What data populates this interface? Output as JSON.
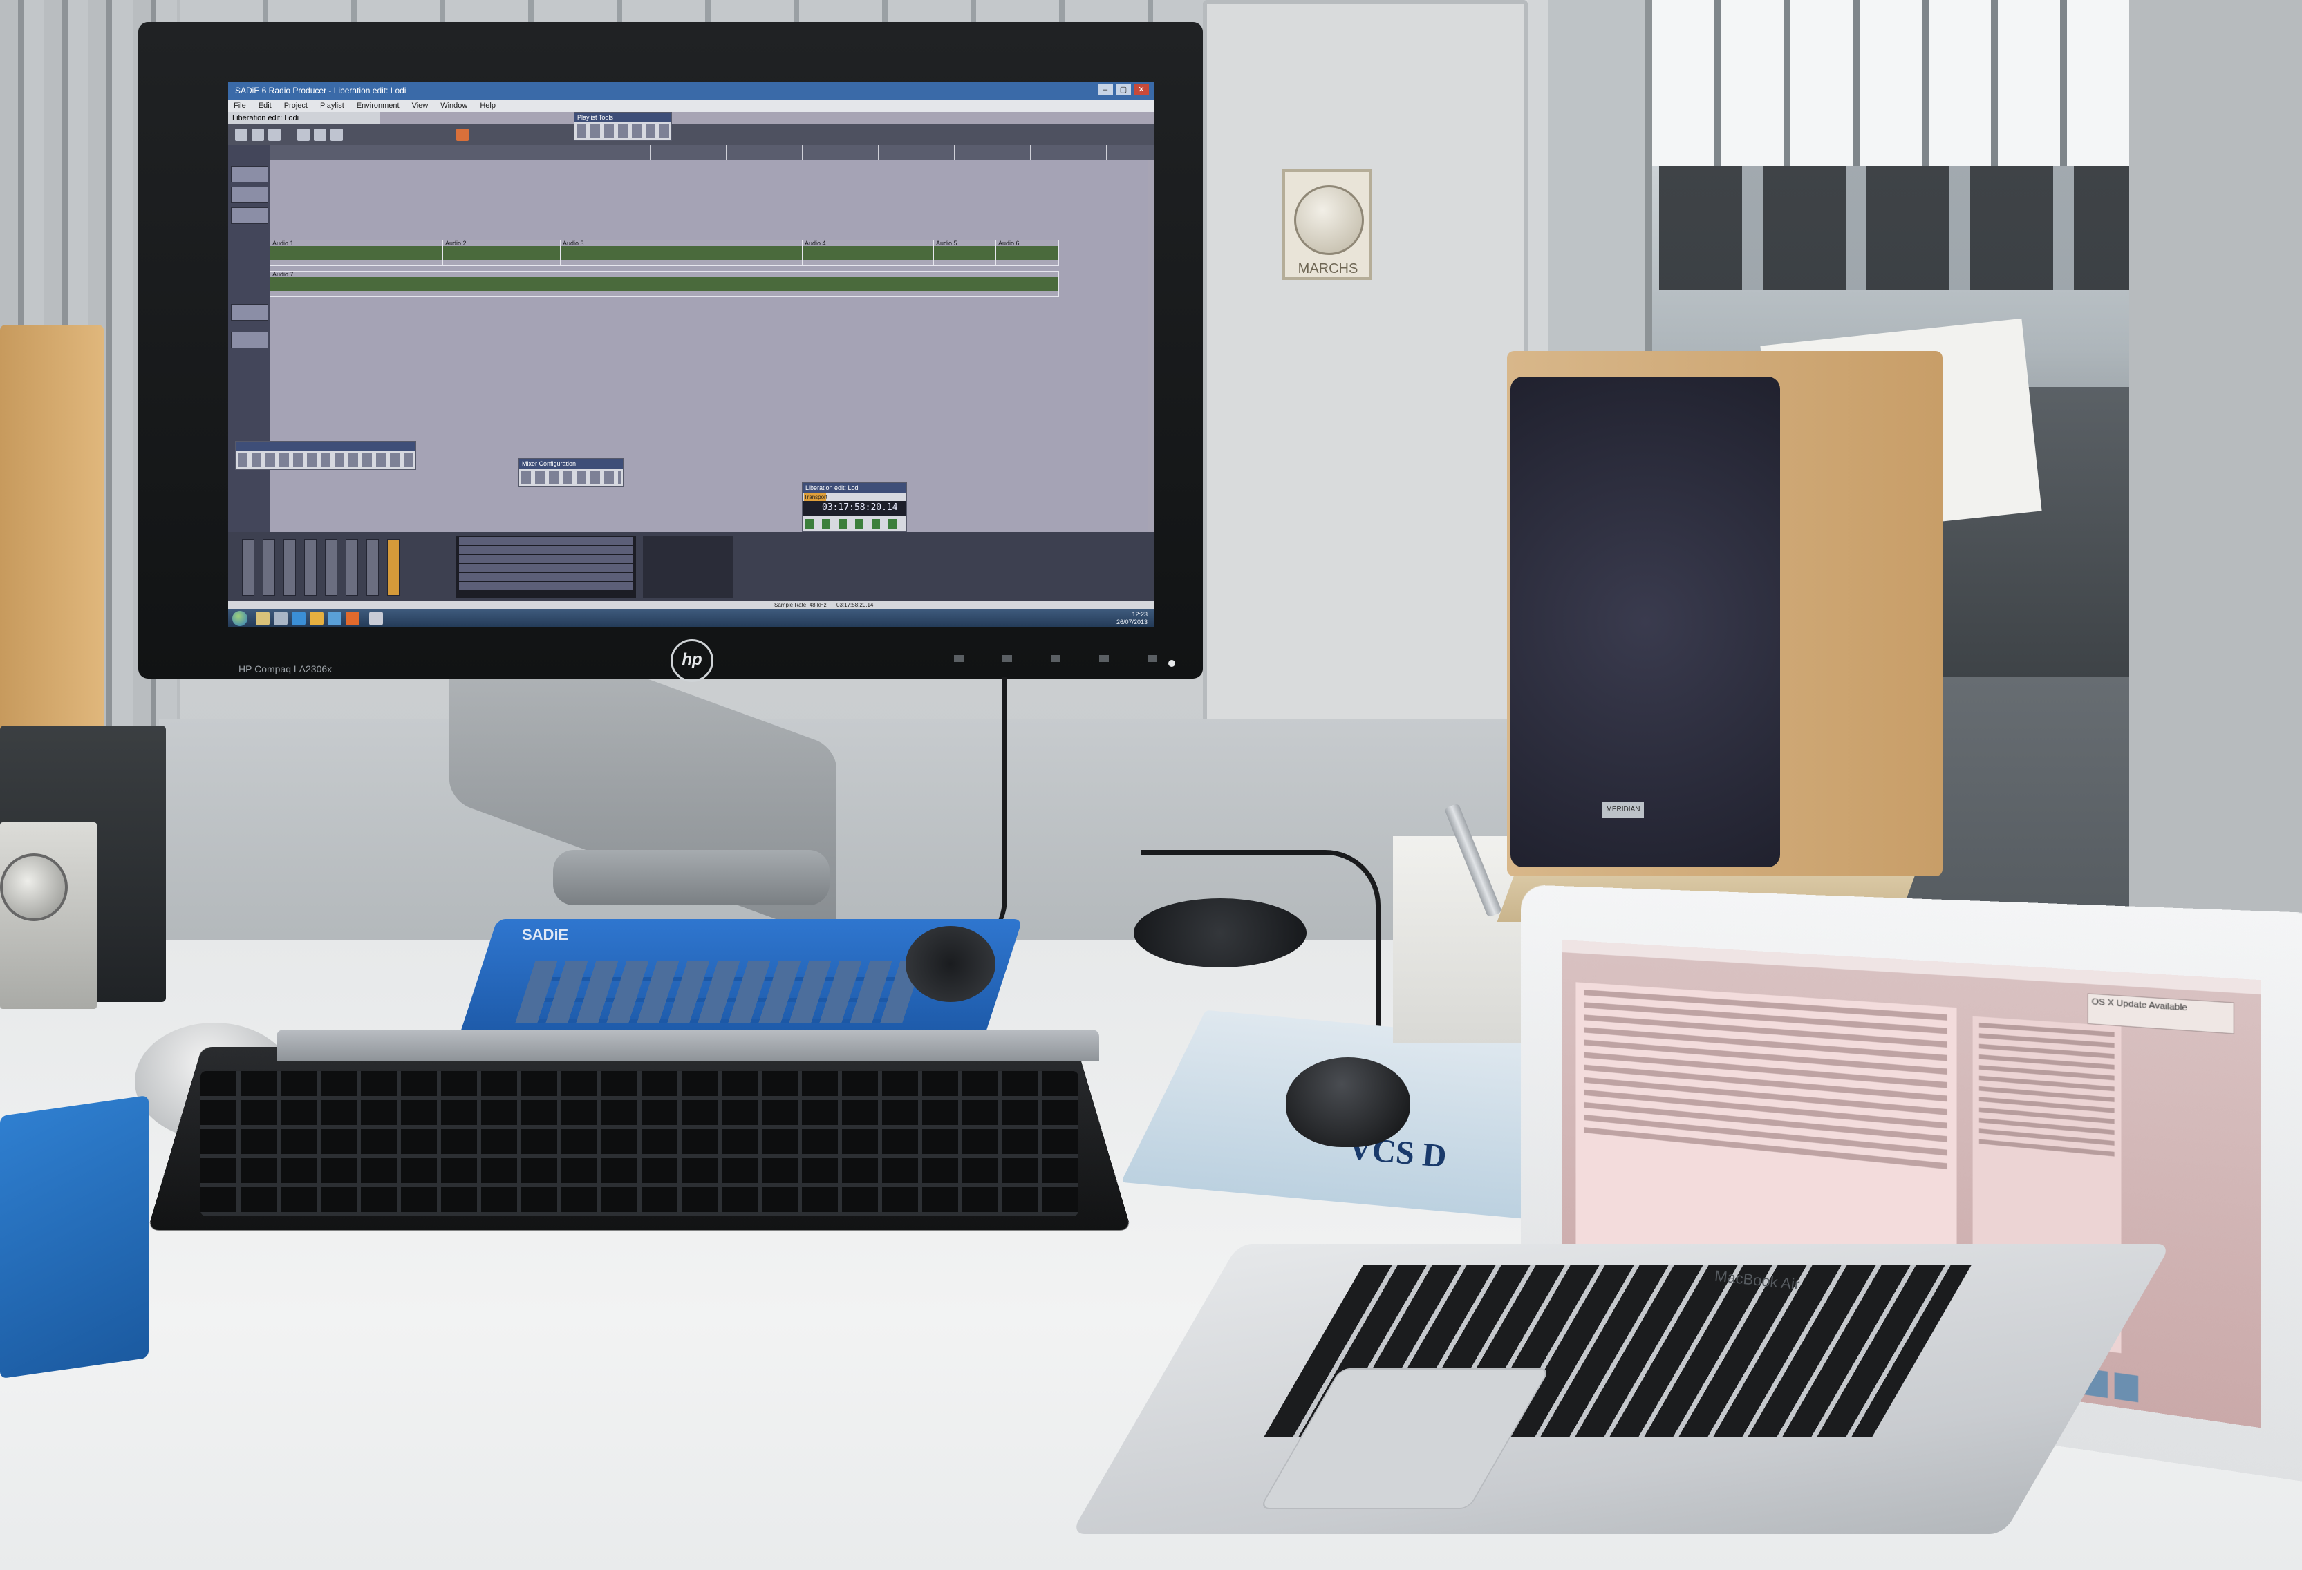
{
  "scene": {
    "monitor_model": "HP Compaq LA2306x",
    "monitor_logo": "hp",
    "speaker_badge": "MERIDIAN",
    "switch_brand": "MARCHS",
    "controller_label": "SADiE",
    "mousepad_text": "VCS D",
    "laptop_label": "MacBook Air"
  },
  "app": {
    "title": "SADiE 6 Radio Producer - Liberation edit: Lodi",
    "menu": [
      "File",
      "Edit",
      "Project",
      "Playlist",
      "Environment",
      "View",
      "Window",
      "Help"
    ],
    "project_tab": "Liberation edit: Lodi",
    "window_controls": [
      "–",
      "▢",
      "✕"
    ],
    "track_panel_title": "Playlist Tools",
    "mixer_panel_title": "Mixer Configuration",
    "transport": {
      "title": "Liberation edit: Lodi",
      "tab": "Transport",
      "time": "03:17:58:20.14"
    },
    "clips": [
      {
        "label": "Audio 1"
      },
      {
        "label": "Audio 2"
      },
      {
        "label": "Audio 3"
      },
      {
        "label": "Audio 4"
      },
      {
        "label": "Audio 5"
      },
      {
        "label": "Audio 6"
      },
      {
        "label": "Audio 7"
      }
    ],
    "status": {
      "sample_rate": "Sample Rate: 48 kHz",
      "time": "03:17:58:20.14"
    },
    "clock": {
      "time": "12:23",
      "date": "26/07/2013"
    }
  },
  "laptop": {
    "notification": "OS X Update Available"
  },
  "icons": {
    "start": "windows-start-icon",
    "taskbar": [
      "folder-icon",
      "media-icon",
      "ie-icon",
      "explorer-icon",
      "firefox-icon",
      "sadie-icon"
    ]
  }
}
